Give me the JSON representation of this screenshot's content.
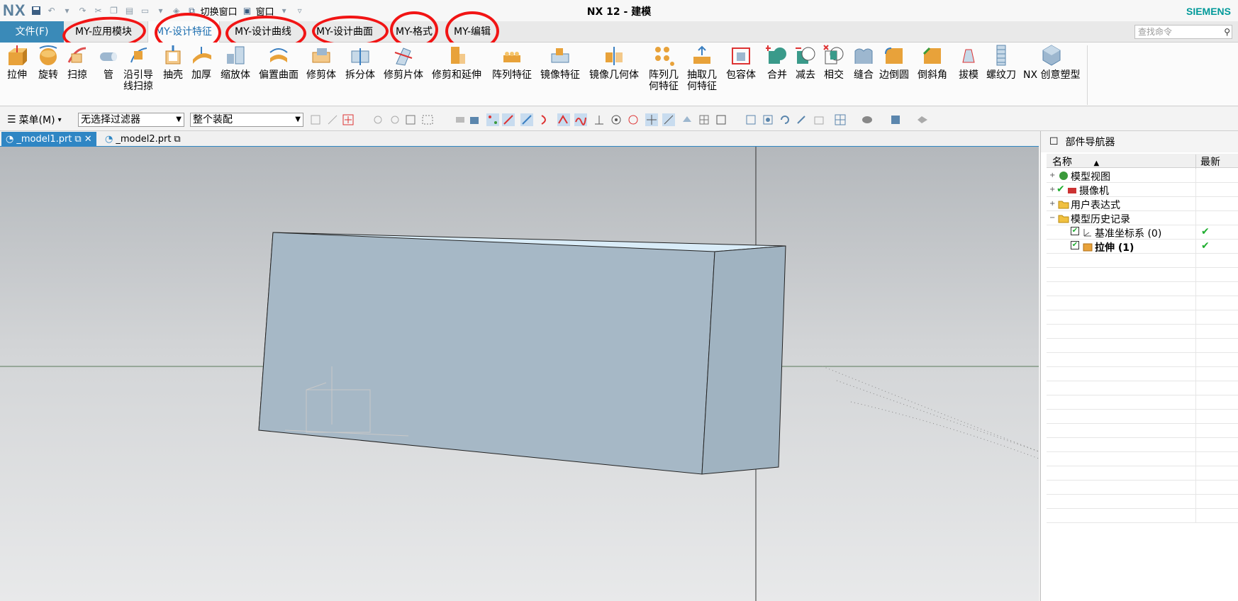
{
  "app": {
    "logo": "NX",
    "title": "NX 12 - 建模",
    "brand": "SIEMENS",
    "switch_window": "切换窗口",
    "window_menu": "窗口"
  },
  "tabs": {
    "file": "文件(F)",
    "items": [
      "MY-应用模块",
      "MY-设计特征",
      "MY-设计曲线",
      "MY-设计曲面",
      "MY-格式",
      "MY-编辑"
    ],
    "active_index": 1,
    "search_placeholder": "查找命令"
  },
  "ribbon": {
    "buttons": [
      {
        "label": "拉伸",
        "icon": "extrude-icon"
      },
      {
        "label": "旋转",
        "icon": "revolve-icon"
      },
      {
        "label": "扫掠",
        "icon": "sweep-icon"
      },
      {
        "label": "管",
        "icon": "tube-icon"
      },
      {
        "label": "沿引导\n线扫掠",
        "icon": "sweep-along-guide-icon"
      },
      {
        "label": "抽壳",
        "icon": "shell-icon"
      },
      {
        "label": "加厚",
        "icon": "thicken-icon"
      },
      {
        "label": "缩放体",
        "icon": "scale-body-icon"
      },
      {
        "label": "偏置曲面",
        "icon": "offset-surface-icon"
      },
      {
        "label": "修剪体",
        "icon": "trim-body-icon"
      },
      {
        "label": "拆分体",
        "icon": "split-body-icon"
      },
      {
        "label": "修剪片体",
        "icon": "trim-sheet-icon"
      },
      {
        "label": "修剪和延伸",
        "icon": "trim-extend-icon"
      },
      {
        "label": "阵列特征",
        "icon": "pattern-feature-icon"
      },
      {
        "label": "镜像特征",
        "icon": "mirror-feature-icon"
      },
      {
        "label": "镜像几何体",
        "icon": "mirror-geometry-icon"
      },
      {
        "label": "阵列几\n何特征",
        "icon": "pattern-geometry-icon"
      },
      {
        "label": "抽取几\n何特征",
        "icon": "extract-geometry-icon"
      },
      {
        "label": "包容体",
        "icon": "bounding-body-icon"
      },
      {
        "label": "合并",
        "icon": "unite-icon"
      },
      {
        "label": "减去",
        "icon": "subtract-icon"
      },
      {
        "label": "相交",
        "icon": "intersect-icon"
      },
      {
        "label": "缝合",
        "icon": "sew-icon"
      },
      {
        "label": "边倒圆",
        "icon": "edge-blend-icon"
      },
      {
        "label": "倒斜角",
        "icon": "chamfer-icon"
      },
      {
        "label": "拔模",
        "icon": "draft-icon"
      },
      {
        "label": "螺纹刀",
        "icon": "thread-icon"
      },
      {
        "label": "NX 创意塑型",
        "icon": "realize-shape-icon"
      }
    ]
  },
  "selection_bar": {
    "menu_label": "菜单(M)",
    "filter_value": "无选择过滤器",
    "scope_value": "整个装配"
  },
  "documents": [
    "_model1.prt",
    "_model2.prt"
  ],
  "navigator": {
    "title": "部件导航器",
    "col_name": "名称",
    "col_latest": "最新",
    "rows": [
      {
        "label": "模型视图",
        "indent": 0,
        "icon": "model-views-icon",
        "checked": false,
        "latest": ""
      },
      {
        "label": "摄像机",
        "indent": 0,
        "icon": "camera-icon",
        "checked": true,
        "latest": ""
      },
      {
        "label": "用户表达式",
        "indent": 0,
        "icon": "folder-icon",
        "checked": false,
        "latest": ""
      },
      {
        "label": "模型历史记录",
        "indent": 0,
        "icon": "folder-icon",
        "checked": false,
        "latest": ""
      },
      {
        "label": "基准坐标系 (0)",
        "indent": 1,
        "icon": "datum-csys-icon",
        "checked": true,
        "latest": "✔"
      },
      {
        "label": "拉伸 (1)",
        "indent": 1,
        "icon": "extrude-icon",
        "checked": true,
        "latest": "✔",
        "bold": true
      }
    ]
  },
  "colors": {
    "accent": "#2f86c4",
    "file_tab": "#3a8ab8",
    "annotation": "#f11414",
    "brand": "#009999"
  }
}
